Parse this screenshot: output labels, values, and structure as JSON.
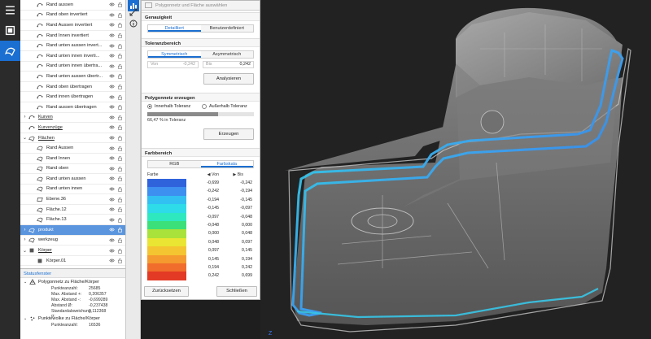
{
  "dialog": {
    "title": "Polygonnetz und Fläche auswählen",
    "genauigkeit": {
      "header": "Genauigkeit",
      "tabs": [
        "Detailliert",
        "Benutzerdefiniert"
      ]
    },
    "toleranz": {
      "header": "Toleranzbereich",
      "tabs": [
        "Symmetrisch",
        "Asymmetrisch"
      ],
      "von_label": "Von",
      "von_value": "-0,242",
      "bis_label": "Bis",
      "bis_value": "0,242",
      "analyze_button": "Analysieren"
    },
    "polygonnetz": {
      "header": "Polygonnetz erzeugen",
      "radio_inside": "Innerhalb Toleranz",
      "radio_outside": "Außerhalb Toleranz",
      "progress_text": "66,47 % in Toleranz",
      "progress_percent": 66.47,
      "create_button": "Erzeugen"
    },
    "farbbereich": {
      "header": "Farbbereich",
      "tabs": [
        "RGB",
        "Farbskala"
      ],
      "col_farbe": "Farbe",
      "col_von": "Von",
      "col_bis": "Bis",
      "rows": [
        {
          "color": "#2f63dc",
          "von": "-0,699",
          "bis": "-0,242"
        },
        {
          "color": "#3d8ff0",
          "von": "-0,242",
          "bis": "-0,194"
        },
        {
          "color": "#32c0f2",
          "von": "-0,194",
          "bis": "-0,145"
        },
        {
          "color": "#2edbe8",
          "von": "-0,145",
          "bis": "-0,097"
        },
        {
          "color": "#2ee8c0",
          "von": "-0,097",
          "bis": "-0,048"
        },
        {
          "color": "#3be07a",
          "von": "-0,048",
          "bis": "0,000"
        },
        {
          "color": "#a8e23a",
          "von": "0,000",
          "bis": "0,048"
        },
        {
          "color": "#e9e532",
          "von": "0,048",
          "bis": "0,097"
        },
        {
          "color": "#f4c531",
          "von": "0,097",
          "bis": "0,145"
        },
        {
          "color": "#f59a2f",
          "von": "0,145",
          "bis": "0,194"
        },
        {
          "color": "#f06d2c",
          "von": "0,194",
          "bis": "0,242"
        },
        {
          "color": "#e23a24",
          "von": "0,242",
          "bis": "0,699"
        }
      ]
    },
    "reset_button": "Zurücksetzen",
    "close_button": "Schließen"
  },
  "tree": {
    "items": [
      {
        "label": "Rand aussen",
        "icon": "curve-icon",
        "caret": "",
        "u": false
      },
      {
        "label": "Rand oben invertiert",
        "icon": "curve-icon",
        "caret": "",
        "u": false
      },
      {
        "label": "Rand Aussen invertiert",
        "icon": "curve-icon",
        "caret": "",
        "u": false
      },
      {
        "label": "Rand Innen invertiert",
        "icon": "curve-icon",
        "caret": "",
        "u": false
      },
      {
        "label": "Rand unten aussen invert...",
        "icon": "curve-icon",
        "caret": "",
        "u": false
      },
      {
        "label": "Rand unten innen inverti...",
        "icon": "curve-icon",
        "caret": "",
        "u": false
      },
      {
        "label": "Rand unten innen übertra...",
        "icon": "curve-icon",
        "caret": "",
        "u": false
      },
      {
        "label": "Rand unten aussen übertr...",
        "icon": "curve-icon",
        "caret": "",
        "u": false
      },
      {
        "label": "Rand oben übertragen",
        "icon": "curve-icon",
        "caret": "",
        "u": false
      },
      {
        "label": "Rand innen übertragen",
        "icon": "curve-icon",
        "caret": "",
        "u": false
      },
      {
        "label": "Rand aussen übertragen",
        "icon": "curve-icon",
        "caret": "",
        "u": false
      },
      {
        "label": "Kurven",
        "icon": "curve-icon",
        "caret": "›",
        "u": true
      },
      {
        "label": "Kurvenzüge",
        "icon": "curve-icon",
        "caret": "",
        "u": true
      },
      {
        "label": "Flächen",
        "icon": "surface-icon",
        "caret": "⌄",
        "u": true
      },
      {
        "label": "Rand Aussen",
        "icon": "surface-icon",
        "caret": "",
        "u": false
      },
      {
        "label": "Rand Innen",
        "icon": "surface-icon",
        "caret": "",
        "u": false
      },
      {
        "label": "Rand oben",
        "icon": "surface-icon",
        "caret": "",
        "u": false
      },
      {
        "label": "Rand unten aussen",
        "icon": "surface-icon",
        "caret": "",
        "u": false
      },
      {
        "label": "Rand unten innen",
        "icon": "surface-icon",
        "caret": "",
        "u": false
      },
      {
        "label": "Ebene.36",
        "icon": "plane-icon",
        "caret": "",
        "u": false
      },
      {
        "label": "Fläche.12",
        "icon": "surface-icon",
        "caret": "",
        "u": false
      },
      {
        "label": "Fläche.13",
        "icon": "surface-icon",
        "caret": "",
        "u": false
      },
      {
        "label": "produkt",
        "icon": "surface-icon",
        "caret": "›",
        "u": false
      },
      {
        "label": "werkzeug",
        "icon": "surface-icon",
        "caret": "›",
        "u": false
      },
      {
        "label": "Körper",
        "icon": "body-icon",
        "caret": "⌄",
        "u": true
      },
      {
        "label": "Körper.01",
        "icon": "body-icon",
        "caret": "",
        "u": false
      }
    ]
  },
  "status": {
    "header": "Statusfenster",
    "group1_label": "Polygonnetz zu Fläche/Körper",
    "group1_rows": [
      {
        "k": "Punkteanzahl:",
        "v": "25685"
      },
      {
        "k": "Max. Abstand +:",
        "v": "0,206357"
      },
      {
        "k": "Max. Abstand -:",
        "v": "-0,699289"
      },
      {
        "k": "Abstand Ø:",
        "v": "-0,237438"
      },
      {
        "k": "Standardabweichung σ:",
        "v": "0,112368"
      }
    ],
    "group2_label": "Punktewolke zu Fläche/Körper",
    "group2_rows": [
      {
        "k": "Punkteanzahl:",
        "v": "16536"
      }
    ]
  },
  "viewport": {
    "axis_label": "Z"
  },
  "colors": {
    "accent": "#1b6fd1",
    "selected_row": "#5b95de"
  }
}
